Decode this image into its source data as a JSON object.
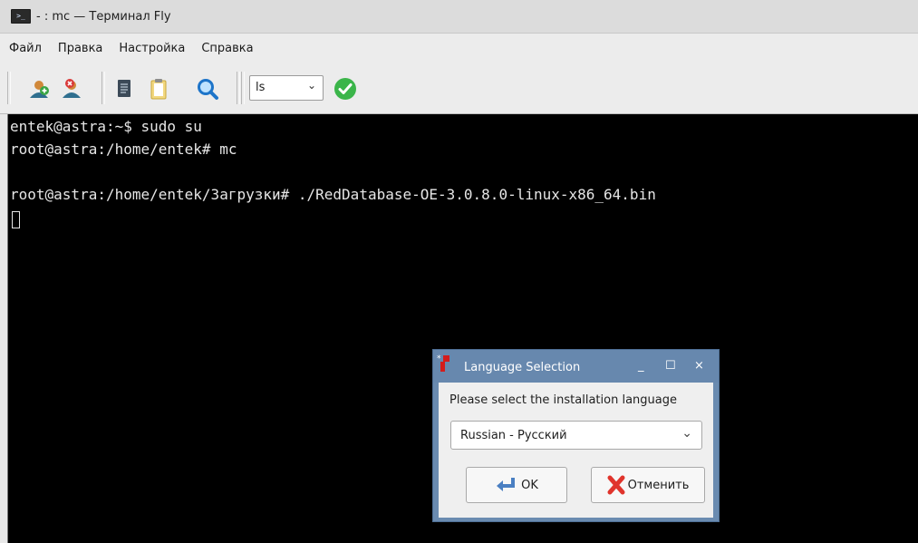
{
  "window": {
    "title": "- : mc — Терминал Fly"
  },
  "menu": [
    "Файл",
    "Правка",
    "Настройка",
    "Справка"
  ],
  "toolbar": {
    "icons": [
      "new-tab-icon",
      "close-tab-icon",
      "copy-icon",
      "paste-icon",
      "search-icon",
      "run-command-icon"
    ],
    "command_combo_value": "ls"
  },
  "terminal": {
    "lines": [
      "entek@astra:~$ sudo su",
      "root@astra:/home/entek# mc",
      "",
      "root@astra:/home/entek/Загрузки# ./RedDatabase-OE-3.0.8.0-linux-x86_64.bin"
    ]
  },
  "dialog": {
    "title": "Language Selection",
    "prompt": "Please select the installation language",
    "selected_language": "Russian - Русский",
    "ok_label": "OK",
    "cancel_label": "Отменить",
    "title_buttons": [
      "_",
      "☐",
      "×"
    ]
  },
  "colors": {
    "terminal_bg": "#000000",
    "terminal_fg": "#e6e6e6",
    "dialog_title_bg": "#6788ae",
    "accept_green": "#3bb54a"
  }
}
